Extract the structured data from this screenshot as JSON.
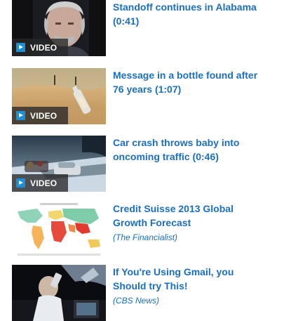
{
  "video_badge_label": "VIDEO",
  "items": [
    {
      "title": "Standoff continues in Alabama\n(0:41)",
      "thumbnail": "man-portrait-thumbnail"
    },
    {
      "title": "Message in a bottle found after\n76 years (1:07)",
      "thumbnail": "desert-bottle-thumbnail"
    },
    {
      "title": "Car crash throws baby into\noncoming traffic (0:46)",
      "thumbnail": "snowy-road-car-thumbnail"
    },
    {
      "title": "Credit Suisse 2013 Global\nGrowth Forecast",
      "source": "(The Financialist)",
      "thumbnail": "world-map-thumbnail"
    },
    {
      "title": "If You're Using Gmail, you\nShould try This!",
      "source": "(CBS News)",
      "thumbnail": "man-drinking-at-desk-thumbnail"
    }
  ],
  "colors": {
    "link": "#1b6fc0",
    "badge_icon": "#1d8fd6"
  },
  "icons": {
    "video_badge": "play-icon"
  }
}
